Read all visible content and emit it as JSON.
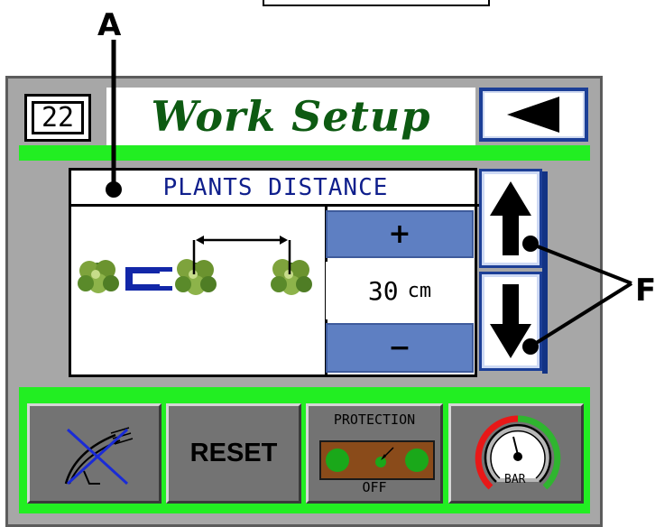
{
  "callouts": {
    "a": "A",
    "f": "F"
  },
  "header": {
    "page_number": "22",
    "title": "Work Setup"
  },
  "panel": {
    "title": "PLANTS DISTANCE",
    "plus_label": "+",
    "minus_label": "−",
    "value": "30",
    "unit": "cm"
  },
  "bottom": {
    "reset_label": "RESET",
    "protection_label": "PROTECTION",
    "protection_state": "OFF",
    "gauge_label": "BAR"
  },
  "icons": [
    "back-arrow-icon",
    "up-arrow-icon",
    "down-arrow-icon",
    "plant-icon",
    "magnet-icon",
    "distance-arrow-icon",
    "harvest-off-icon",
    "protection-icon",
    "pressure-gauge-icon"
  ],
  "colors": {
    "title": "#0d5a12",
    "accent_blue": "#5e7fc2",
    "green_bar": "#22ee22",
    "frame": "#a7a7a7",
    "panel_title": "#0f1f8c"
  }
}
